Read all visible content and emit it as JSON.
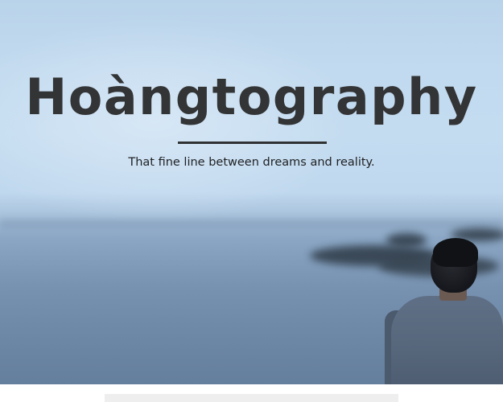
{
  "site": {
    "title": "Hoàngtography",
    "tagline": "That fine line between dreams and reality."
  },
  "hero": {
    "image": "person-looking-at-sea-background",
    "colors": {
      "title": "#333435",
      "divider": "#2f3133",
      "sky": "#c2daef",
      "sea": "#7c97b6"
    }
  }
}
